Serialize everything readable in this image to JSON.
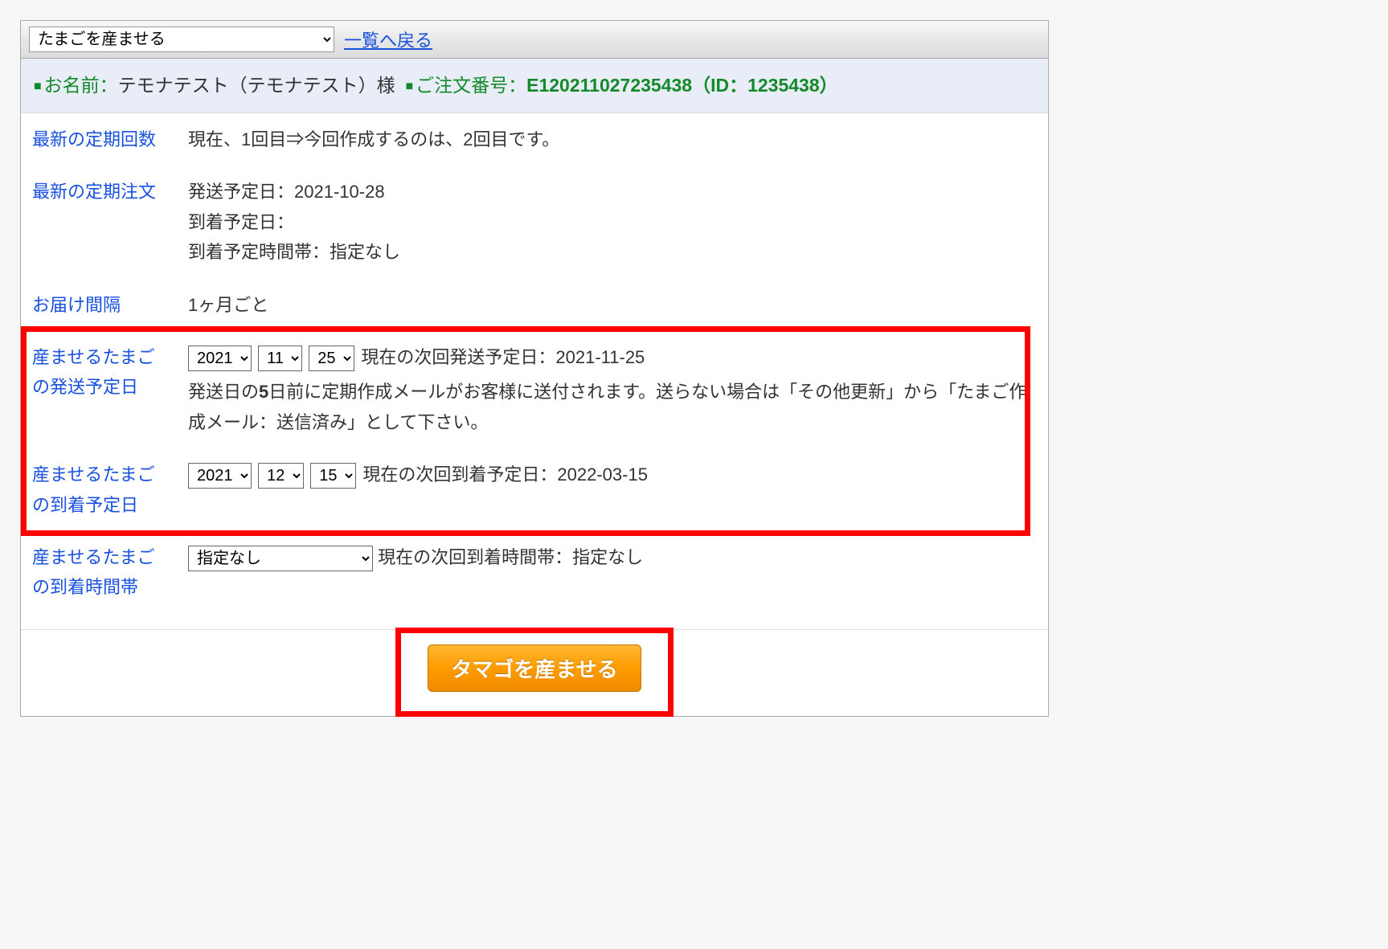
{
  "header": {
    "action_selected": "たまごを産ませる",
    "back_link": "一覧へ戻る"
  },
  "customer": {
    "name_label": "お名前：",
    "name_value": "テモナテスト（テモナテスト）様",
    "order_label": "ご注文番号：",
    "order_number": "E120211027235438",
    "id_suffix": "（ID：1235438）"
  },
  "rows": {
    "cycle_count": {
      "label": "最新の定期回数",
      "value": "現在、1回目⇒今回作成するのは、2回目です。"
    },
    "latest_order": {
      "label": "最新の定期注文",
      "ship_label": "発送予定日：",
      "ship_value": "2021-10-28",
      "arrive_label": "到着予定日：",
      "arrive_tz_label": "到着予定時間帯：",
      "arrive_tz_value": "指定なし"
    },
    "interval": {
      "label": "お届け間隔",
      "value": "1ヶ月ごと"
    },
    "egg_ship": {
      "label": "産ませるたまごの発送予定日",
      "year": "2021",
      "month": "11",
      "day": "25",
      "current_label": "現在の次回発送予定日：",
      "current_value": "2021-11-25",
      "note_prefix": "発送日の",
      "note_days": "5",
      "note_rest": "日前に定期作成メールがお客様に送付されます。送らない場合は「その他更新」から「たまご作成メール：送信済み」として下さい。"
    },
    "egg_arrive": {
      "label": "産ませるたまごの到着予定日",
      "year": "2021",
      "month": "12",
      "day": "15",
      "current_label": "現在の次回到着予定日：",
      "current_value": "2022-03-15"
    },
    "egg_tz": {
      "label": "産ませるたまごの到着時間帯",
      "selected": "指定なし",
      "current_label": "現在の次回到着時間帯：",
      "current_value": "指定なし"
    }
  },
  "footer": {
    "submit_label": "タマゴを産ませる"
  }
}
